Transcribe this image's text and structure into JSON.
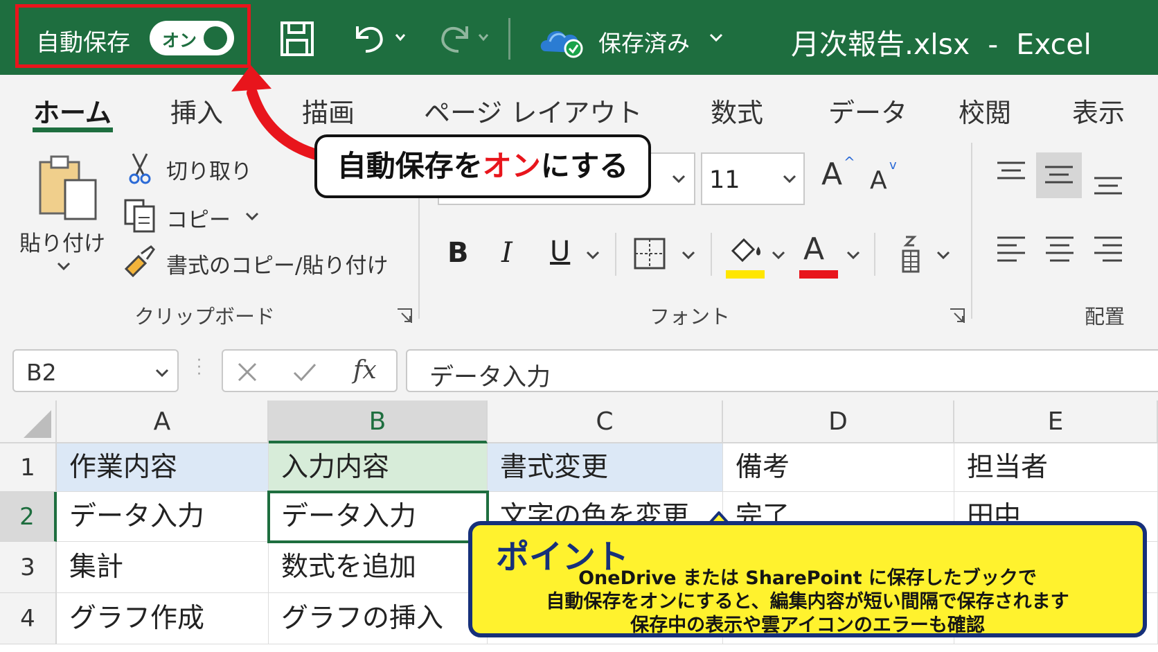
{
  "titlebar": {
    "autosave_label": "自動保存",
    "toggle_label": "オン",
    "save_status": "保存済み",
    "document_title": "月次報告.xlsx  -  Excel"
  },
  "tabs": [
    "ホーム",
    "挿入",
    "描画",
    "ページ レイアウト",
    "数式",
    "データ",
    "校閲",
    "表示"
  ],
  "callout": {
    "prefix": "自動保存を",
    "highlight": "オン",
    "suffix": "にする"
  },
  "clipboard": {
    "paste_label_1": "貼り付け",
    "cut_label": "切り取り",
    "copy_label": "コピー",
    "format_painter_label": "書式のコピー/貼り付け",
    "group_label": "クリップボード"
  },
  "font": {
    "size": "11",
    "bold": "B",
    "italic": "I",
    "underline": "U",
    "grow": "A",
    "shrink": "A",
    "font_color": "A",
    "group_label": "フォント",
    "highlight_color": "#ffe600",
    "font_color_bar": "#e8151c"
  },
  "alignment": {
    "group_label": "配置"
  },
  "formula_bar": {
    "name_box": "B2",
    "fx": "fx",
    "formula": "データ入力"
  },
  "grid": {
    "columns": [
      "A",
      "B",
      "C",
      "D",
      "E"
    ],
    "rows": [
      {
        "num": "1",
        "cells": [
          "作業内容",
          "入力内容",
          "書式変更",
          "備考",
          "担当者"
        ]
      },
      {
        "num": "2",
        "cells": [
          "データ入力",
          "データ入力",
          "文字の色を変更",
          "完了",
          "田中"
        ]
      },
      {
        "num": "3",
        "cells": [
          "集計",
          "数式を追加",
          "",
          "",
          ""
        ]
      },
      {
        "num": "4",
        "cells": [
          "グラフ作成",
          "グラフの挿入",
          "",
          "",
          ""
        ]
      }
    ]
  },
  "point_box": {
    "title": "ポイント",
    "line1": "OneDrive または SharePoint に保存したブックで",
    "line2": "自動保存をオンにすると、編集内容が短い間隔で保存されます",
    "line3": "保存中の表示や雲アイコンのエラーも確認"
  },
  "colors": {
    "excel_green": "#1e6e3f",
    "callout_red": "#e8151c",
    "point_yellow": "#fff22e",
    "point_border": "#16307a"
  }
}
